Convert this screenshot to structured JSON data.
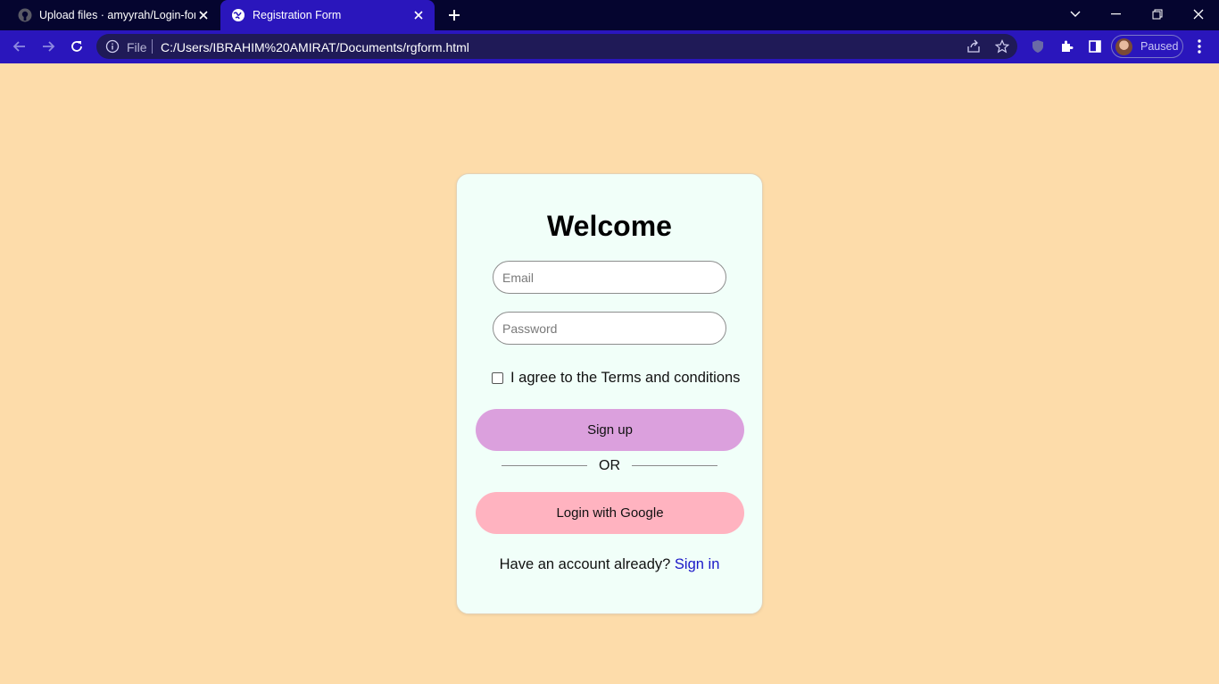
{
  "browser": {
    "tabs": [
      {
        "title": "Upload files · amyyrah/Login-form",
        "active": false,
        "icon": "github-icon"
      },
      {
        "title": "Registration Form",
        "active": true,
        "icon": "globe-icon"
      }
    ],
    "address_bar": {
      "scheme_label": "File",
      "url": "C:/Users/IBRAHIM%20AMIRAT/Documents/rgform.html"
    },
    "profile_status": "Paused",
    "colors": {
      "tabbar": "#05052f",
      "toolbar": "#2a16bc"
    }
  },
  "page": {
    "background": "#fddcaa",
    "heading": "Welcome",
    "email_placeholder": "Email",
    "password_placeholder": "Password",
    "terms_label": "I agree to the Terms and conditions",
    "terms_checked": false,
    "signup_label": "Sign up",
    "or_label": "OR",
    "google_label": "Login with Google",
    "signin_prompt": "Have an account already?",
    "signin_link": "Sign in",
    "colors": {
      "card": "#f1fff9",
      "signup": "#dba0dd",
      "google": "#ffb3c0",
      "link": "#1a17c8"
    }
  }
}
